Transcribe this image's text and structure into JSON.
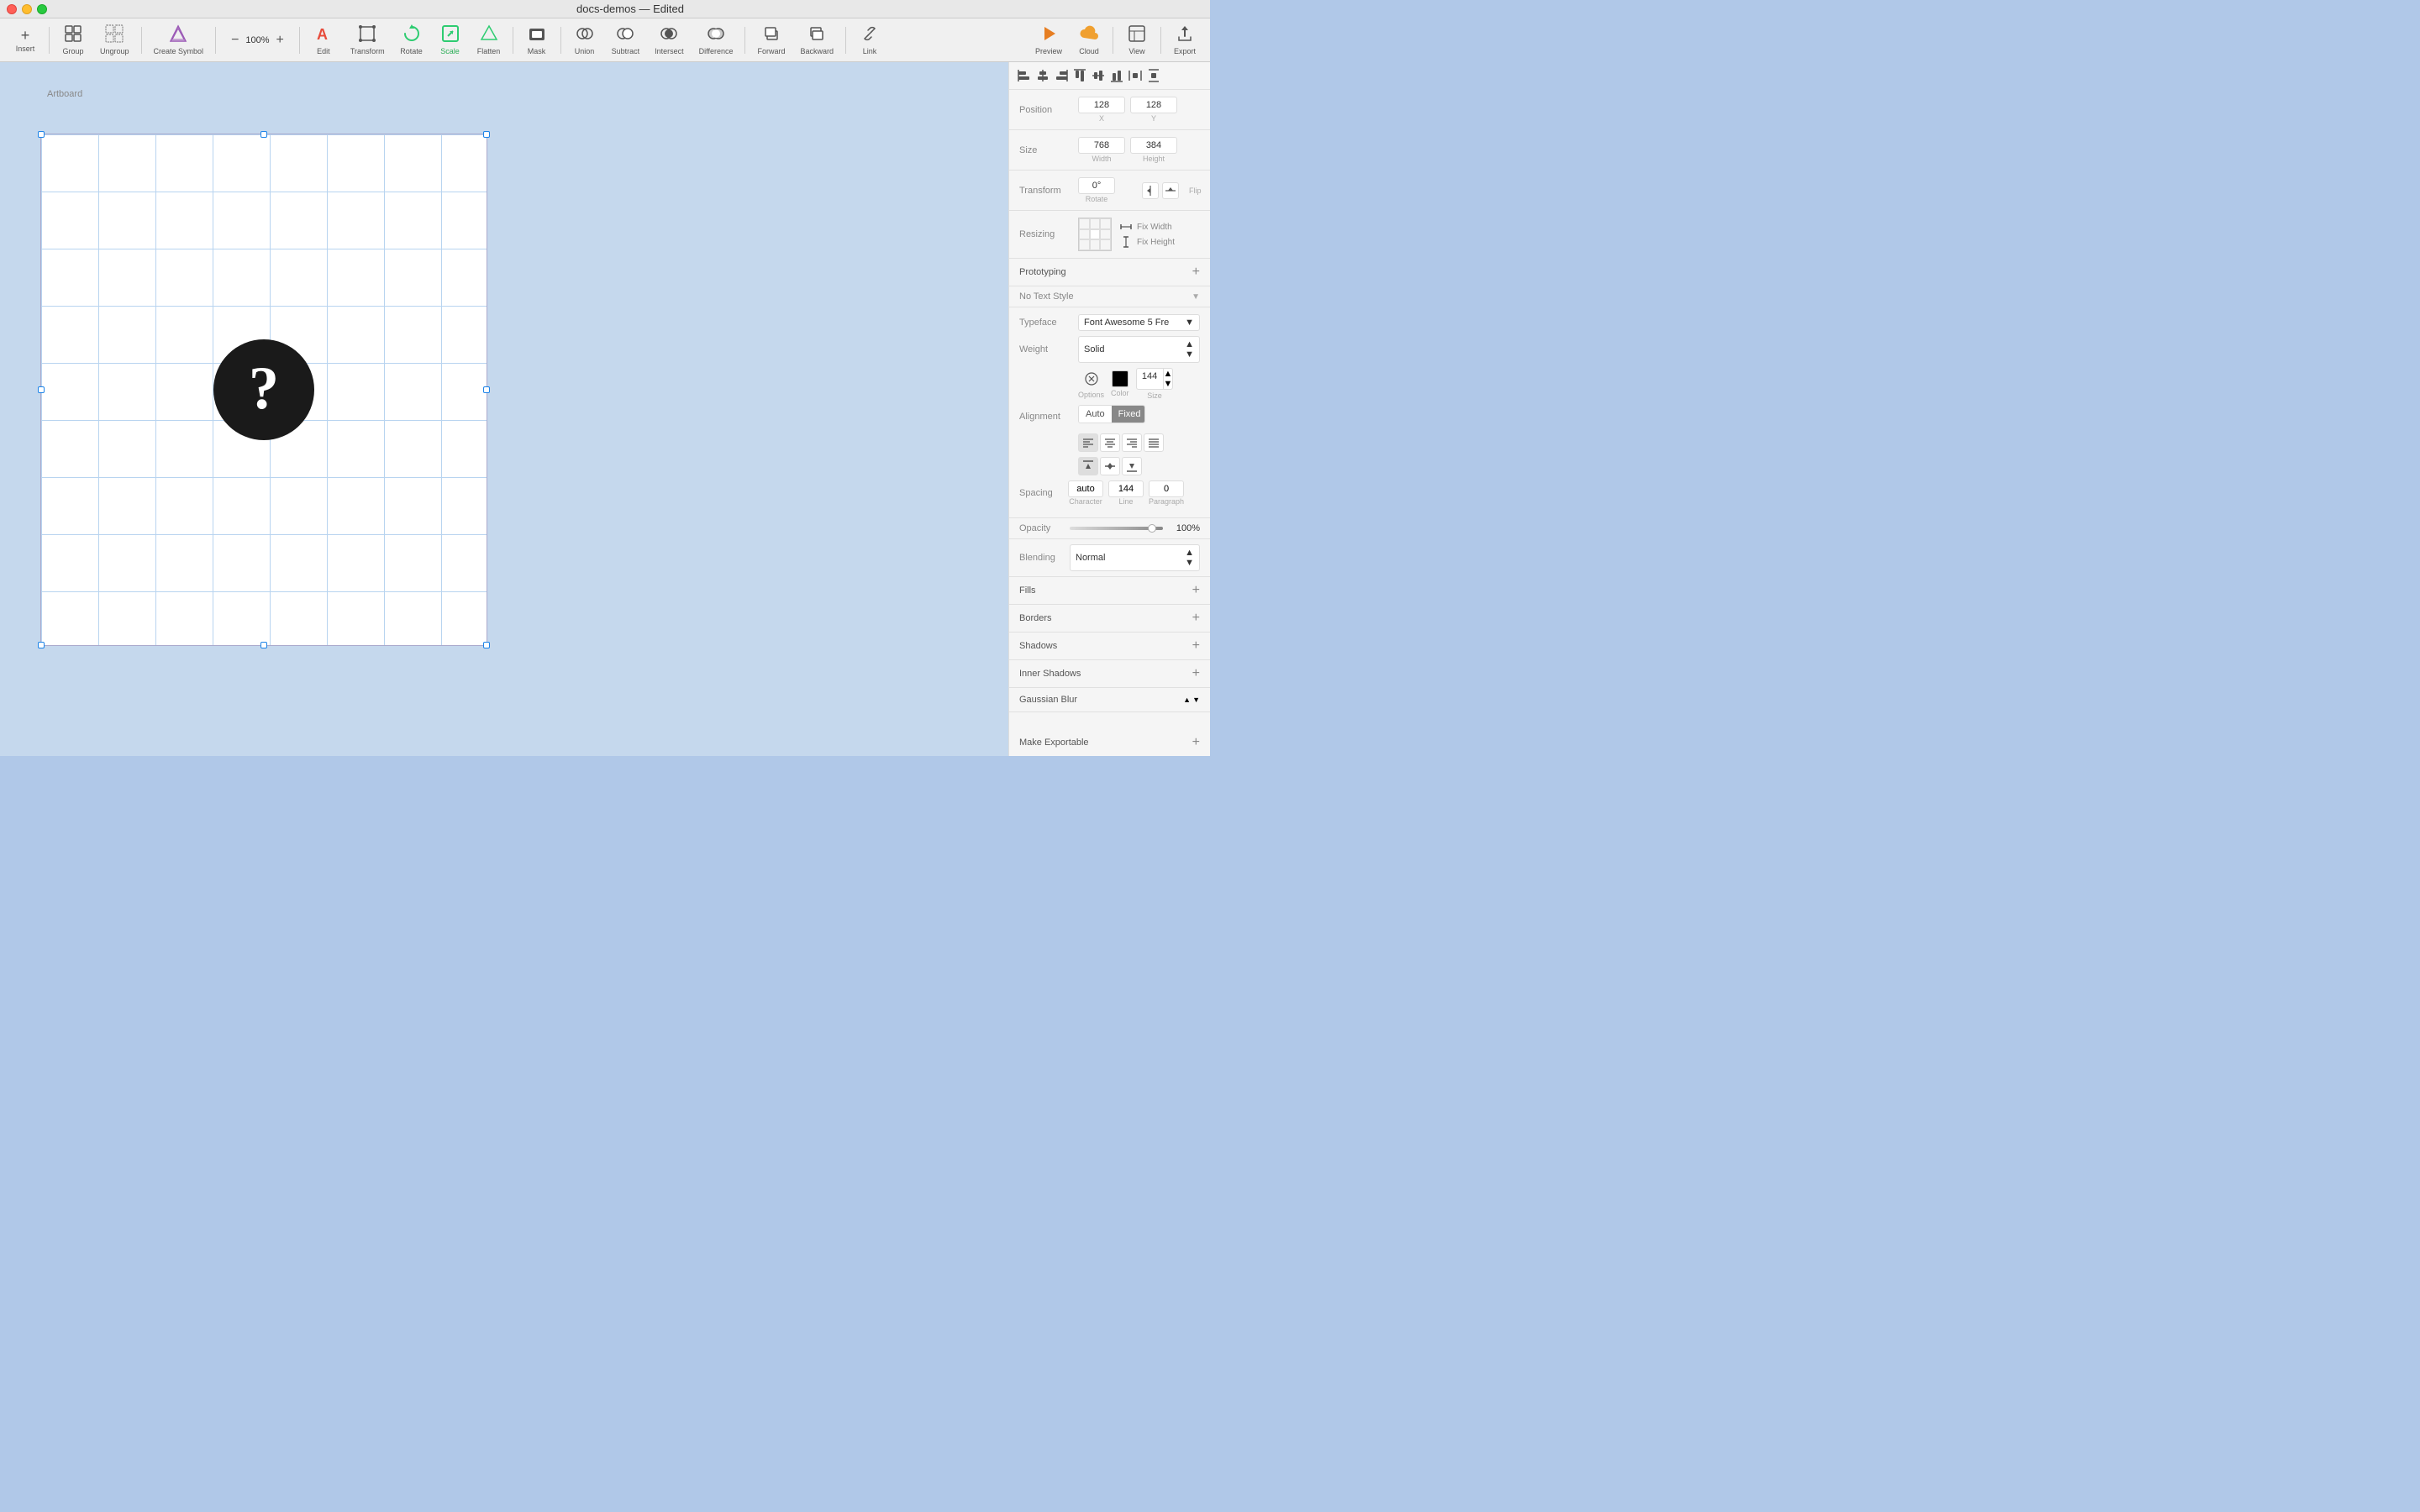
{
  "titlebar": {
    "filename": "docs-demos",
    "status": "Edited"
  },
  "toolbar": {
    "insert_label": "Insert",
    "group_label": "Group",
    "ungroup_label": "Ungroup",
    "create_symbol_label": "Create Symbol",
    "zoom_value": "100%",
    "edit_label": "Edit",
    "transform_label": "Transform",
    "rotate_label": "Rotate",
    "flatten_label": "Flatten",
    "mask_label": "Mask",
    "scale_label": "Scale",
    "union_label": "Union",
    "subtract_label": "Subtract",
    "intersect_label": "Intersect",
    "difference_label": "Difference",
    "forward_label": "Forward",
    "backward_label": "Backward",
    "link_label": "Link",
    "preview_label": "Preview",
    "cloud_label": "Cloud",
    "view_label": "View",
    "export_label": "Export"
  },
  "alignment": {
    "buttons": [
      "align-left",
      "align-center-h",
      "align-right",
      "align-top",
      "align-center-v",
      "align-bottom",
      "distribute-h",
      "distribute-v"
    ]
  },
  "panel": {
    "position": {
      "label": "Position",
      "x_value": "128",
      "x_label": "X",
      "y_value": "128",
      "y_label": "Y"
    },
    "size": {
      "label": "Size",
      "width_value": "768",
      "width_label": "Width",
      "height_value": "384",
      "height_label": "Height"
    },
    "transform": {
      "label": "Transform",
      "rotate_value": "0°",
      "rotate_label": "Rotate",
      "flip_label": "Flip"
    },
    "resizing": {
      "label": "Resizing",
      "fix_width_label": "Fix Width",
      "fix_height_label": "Fix Height"
    },
    "prototyping": {
      "label": "Prototyping"
    },
    "text_style": {
      "label": "No Text Style"
    },
    "typeface": {
      "label": "Typeface",
      "value": "Font Awesome 5 Fre"
    },
    "weight": {
      "label": "Weight",
      "value": "Solid"
    },
    "text_options": {
      "options_label": "Options",
      "color_label": "Color",
      "size_value": "144",
      "size_label": "Size"
    },
    "alignment_label": "Alignment",
    "alignment_auto": "Auto",
    "alignment_fixed": "Fixed",
    "spacing": {
      "label": "Spacing",
      "character_value": "auto",
      "character_label": "Character",
      "line_value": "144",
      "line_label": "Line",
      "paragraph_value": "0",
      "paragraph_label": "Paragraph"
    },
    "opacity": {
      "label": "Opacity",
      "value": "100%"
    },
    "blending": {
      "label": "Blending",
      "value": "Normal"
    },
    "fills_label": "Fills",
    "borders_label": "Borders",
    "shadows_label": "Shadows",
    "inner_shadows_label": "Inner Shadows",
    "gaussian_blur_label": "Gaussian Blur",
    "make_exportable_label": "Make Exportable"
  },
  "canvas": {
    "artboard_label": "Artboard"
  }
}
